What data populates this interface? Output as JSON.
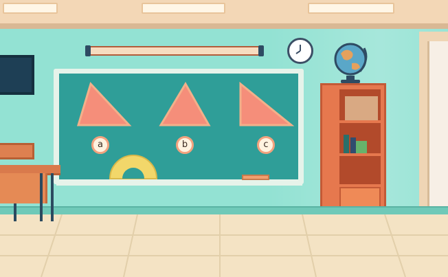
{
  "scene": {
    "labels": {
      "a": "a",
      "b": "b",
      "c": "c"
    }
  },
  "colors": {
    "wall": "#93e2d3",
    "board": "#2f9e98",
    "triangle": "#f58e7a",
    "floor": "#f4e3c4",
    "wood": "#e6784e"
  },
  "icons": [
    "globe-icon",
    "clock-icon",
    "protractor-icon",
    "eraser-icon",
    "books-icon"
  ]
}
